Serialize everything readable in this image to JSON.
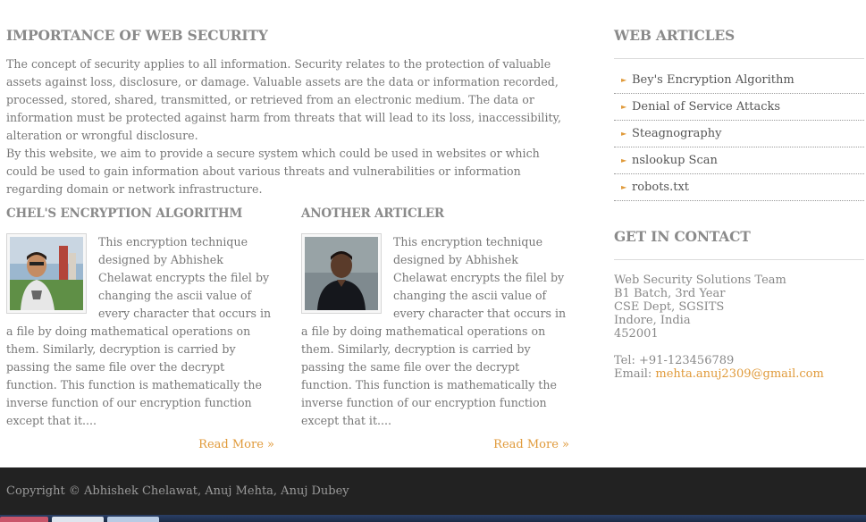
{
  "main": {
    "title": "IMPORTANCE OF WEB SECURITY",
    "intro_p1": "The concept of security applies to all information. Security relates to the protection of valuable assets against loss, disclosure, or damage. Valuable assets are the data or information recorded, processed, stored, shared, transmitted, or retrieved from an electronic medium. The data or information must be protected against harm from threats that will lead to its loss, inaccessibility, alteration or wrongful disclosure.",
    "intro_p2": "By this website, we aim to provide a secure system which could be used in websites or which could be used to gain information about various threats and vulnerabilities or information regarding domain or network infrastructure.",
    "articles": [
      {
        "title": "CHEL'S ENCRYPTION ALGORITHM",
        "text": "This encryption technique designed by Abhishek Chelawat encrypts the filel by changing the ascii value of every character that occurs in a file by doing mathematical operations on them. Similarly, decryption is carried by passing the same file over the decrypt function. This function is mathematically the inverse function of our encryption function except that it....",
        "read_more": "Read More »"
      },
      {
        "title": "ANOTHER ARTICLER",
        "text": "This encryption technique designed by Abhishek Chelawat encrypts the filel by changing the ascii value of every character that occurs in a file by doing mathematical operations on them. Similarly, decryption is carried by passing the same file over the decrypt function. This function is mathematically the inverse function of our encryption function except that it....",
        "read_more": "Read More »"
      }
    ]
  },
  "sidebar": {
    "articles_title": "WEB ARTICLES",
    "articles": [
      "Bey's Encryption Algorithm",
      "Denial of Service Attacks",
      "Steagnography",
      "nslookup Scan",
      "robots.txt"
    ],
    "contact_title": "GET IN CONTACT",
    "contact": {
      "line1": "Web Security Solutions Team",
      "line2": "B1 Batch, 3rd Year",
      "line3": "CSE Dept, SGSITS",
      "line4": "Indore, India",
      "line5": "452001",
      "tel": "Tel: +91-123456789",
      "email_label": "Email: ",
      "email": "mehta.anuj2309@gmail.com"
    }
  },
  "footer": {
    "copyright": "Copyright © Abhishek Chelawat, Anuj Mehta, Anuj Dubey"
  },
  "colors": {
    "accent": "#e09a3a",
    "heading": "#8a8a8a",
    "text": "#777777",
    "footer_bg": "#222222"
  }
}
